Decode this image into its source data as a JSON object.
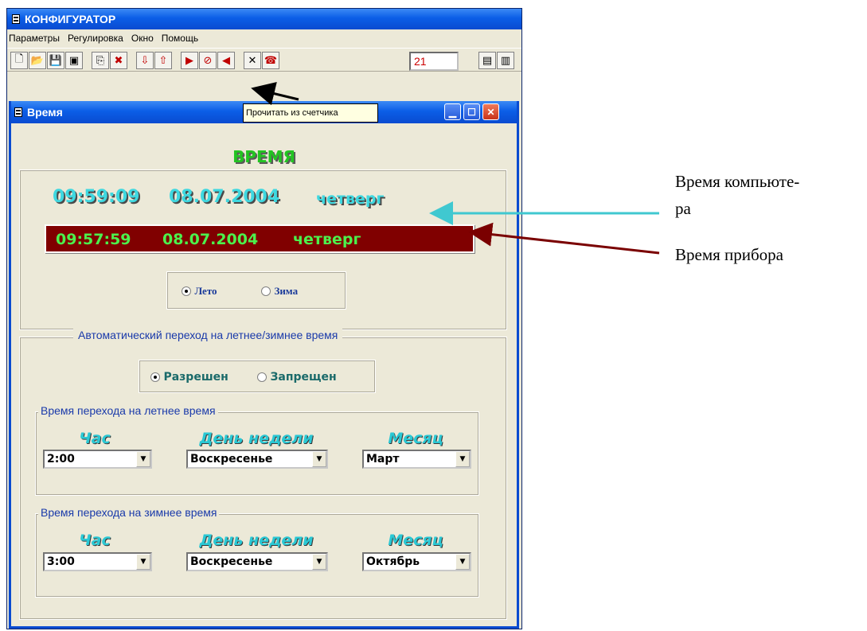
{
  "app": {
    "title": "КОНФИГУРАТОР",
    "menu": [
      "Параметры",
      "Регулировка",
      "Окно",
      "Помощь"
    ],
    "toolbar": {
      "counter_value": "21",
      "tooltip": "Прочитать из счетчика"
    }
  },
  "time_window": {
    "title": "Время",
    "heading": "ВРЕМЯ",
    "computer_time": {
      "time": "09:59:09",
      "date": "08.07.2004",
      "weekday": "четверг"
    },
    "device_time": {
      "time": "09:57:59",
      "date": "08.07.2004",
      "weekday": "четверг"
    },
    "season": {
      "options": [
        "Лето",
        "Зима"
      ],
      "selected": "Лето"
    },
    "auto_switch": {
      "caption": "Автоматический переход на летнее/зимнее время",
      "options": [
        "Разрешен",
        "Запрещен"
      ],
      "selected": "Разрешен"
    },
    "summer": {
      "caption": "Время перехода на летнее время",
      "hour_label": "Час",
      "day_label": "День недели",
      "month_label": "Месяц",
      "hour": "2:00",
      "day": "Воскресенье",
      "month": "Март"
    },
    "winter": {
      "caption": "Время перехода на зимнее время",
      "hour_label": "Час",
      "day_label": "День недели",
      "month_label": "Месяц",
      "hour": "3:00",
      "day": "Воскресенье",
      "month": "Октябрь"
    }
  },
  "annotations": {
    "computer_time_line1": "Время компьюте-",
    "computer_time_line2": "ра",
    "device_time": "Время прибора"
  },
  "colors": {
    "titlebar": "#0b5ee7",
    "device_bar": "#800000",
    "computer_time": "#3ed8e0",
    "device_time": "#4cf14c",
    "arrow_cyan": "#40c8d0",
    "arrow_dark_red": "#7a0000"
  }
}
